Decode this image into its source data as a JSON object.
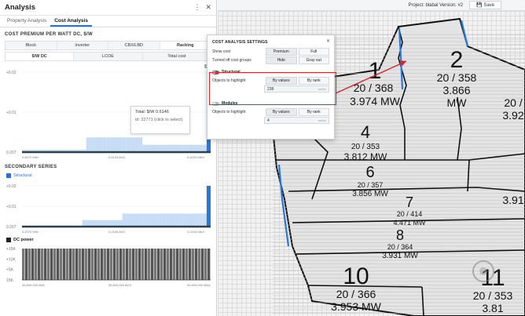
{
  "panel": {
    "title": "Analysis",
    "tabs": [
      {
        "label": "Property Analysis"
      },
      {
        "label": "Cost Analysis"
      }
    ],
    "cost_premium": {
      "title": "COST PREMIUM PER WATT DC, $/W",
      "groups": [
        "Block",
        "Inverter",
        "CBX/LBD",
        "Racking"
      ],
      "metrics": [
        "$/W DC",
        "LCOE",
        "Total cost"
      ]
    },
    "tooltip": {
      "line1": "Total: $/W 0.6146",
      "line2": "id: 22771 (click to select)"
    },
    "secondary": {
      "title": "SECONDARY SERIES",
      "legend": "Structural"
    },
    "dc_power": {
      "legend": "DC power"
    }
  },
  "topbar": {
    "project": "Project: blabal Version: #2",
    "save": "Save"
  },
  "popup": {
    "title": "COST ANALYSIS SETTINGS",
    "show_cost": {
      "label": "Show cost",
      "options": [
        "Premium",
        "Full"
      ]
    },
    "turned_off": {
      "label": "Turned off cost groups",
      "options": [
        "Hide",
        "Gray out"
      ]
    },
    "structural": {
      "name": "Structural",
      "label": "Objects to highlight",
      "options": [
        "By values",
        "By rank"
      ],
      "value": "238",
      "suffix": "sat lim"
    },
    "modules": {
      "name": "Modules",
      "label": "Objects to highlight",
      "options": [
        "By values",
        "By rank"
      ],
      "value": "4",
      "suffix": "sat lim"
    }
  },
  "map": {
    "blocks": [
      {
        "num": "1",
        "ratio": "20 / 368",
        "mw": "3.974 MW"
      },
      {
        "num": "2",
        "ratio": "20 / 358",
        "mw": "3.866"
      },
      {
        "num": "",
        "ratio": "",
        "mw": "MW"
      },
      {
        "num": "",
        "ratio": "20 /",
        "mw": "3.92"
      },
      {
        "num": "4",
        "ratio": "20 / 353",
        "mw": "3.812 MW"
      },
      {
        "num": "6",
        "ratio": "20 / 357",
        "mw": "3.856 MW"
      },
      {
        "num": "",
        "ratio": "",
        "mw": "3.91"
      },
      {
        "num": "7",
        "ratio": "20 / 414",
        "mw": "4.471 MW"
      },
      {
        "num": "8",
        "ratio": "20 / 364",
        "mw": "3.931 MW"
      },
      {
        "num": "10",
        "ratio": "20 / 366",
        "mw": "3.953 MW"
      },
      {
        "num": "11",
        "ratio": "20 / 353",
        "mw": "3.81"
      }
    ]
  },
  "chart_data": [
    {
      "type": "bar",
      "title": "COST PREMIUM PER WATT DC, $/W",
      "yticks": [
        "+0.02",
        "+0.01",
        "0.207"
      ],
      "xticks": [
        "0.6072 MIN",
        "0.6133 AVG",
        "0.6220 MAX"
      ],
      "series": [
        {
          "values": [
            0.2,
            0.2,
            0.2,
            0.2,
            0.2,
            0.2,
            0.2,
            0.2,
            0.2,
            0.2,
            0.2,
            0.2,
            0.2,
            0.2,
            0.2,
            0.2,
            1.2,
            1.2,
            1.2,
            1.2,
            1.2,
            1.2,
            1.2,
            1.2,
            1.2,
            1.2,
            1.2,
            1.2,
            1.2,
            1.2,
            0.6,
            0.6,
            0.6,
            0.6,
            0.6,
            0.6,
            0.6,
            0.6,
            0.6,
            0.6,
            0.6,
            0.6,
            0.6,
            0.6,
            0.6,
            0.6,
            6.5
          ]
        }
      ]
    },
    {
      "type": "bar",
      "title": "SECONDARY SERIES",
      "yticks": [
        "+0.02",
        "+0.01",
        "0.207"
      ],
      "xticks": [
        "0.2070 MIN",
        "0.2108 AVG",
        "0.2218 MAX"
      ],
      "series": [
        {
          "name": "Structural",
          "values": [
            0.1,
            0.1,
            0.1,
            0.1,
            0.1,
            0.1,
            0.1,
            0.1,
            0.1,
            0.1,
            0.1,
            0.1,
            0.1,
            0.1,
            0.1,
            0.8,
            0.8,
            0.8,
            0.8,
            0.8,
            0.8,
            0.8,
            0.8,
            0.8,
            0.8,
            1.6,
            1.6,
            1.6,
            1.6,
            1.6,
            1.6,
            1.6,
            1.6,
            1.6,
            1.6,
            1.6,
            1.6,
            1.6,
            1.6,
            1.6,
            1.6,
            1.6,
            1.6,
            1.6,
            1.6,
            1.6,
            5.0
          ]
        }
      ]
    },
    {
      "type": "bar",
      "title": "DC power",
      "yticks": [
        "+15K",
        "+10K",
        "+5K",
        "15K"
      ],
      "xticks": [
        "33,800,000 MIN",
        "35,800,000 AVG",
        "34,800,000 MAX"
      ],
      "series": [
        {
          "name": "DC power",
          "values": [
            1,
            1,
            1,
            1,
            1,
            1,
            1,
            1,
            1,
            1,
            1,
            1,
            1,
            1,
            1,
            1,
            1,
            1,
            1,
            1,
            1,
            1,
            1,
            1,
            1,
            1,
            1,
            1,
            1,
            1,
            1,
            1,
            1,
            1,
            1,
            1,
            1,
            1,
            1,
            1,
            1,
            1,
            1,
            1,
            1,
            1,
            1,
            1,
            1,
            1,
            1,
            1,
            1,
            1,
            1,
            1,
            1,
            1,
            1,
            1
          ]
        }
      ]
    }
  ]
}
